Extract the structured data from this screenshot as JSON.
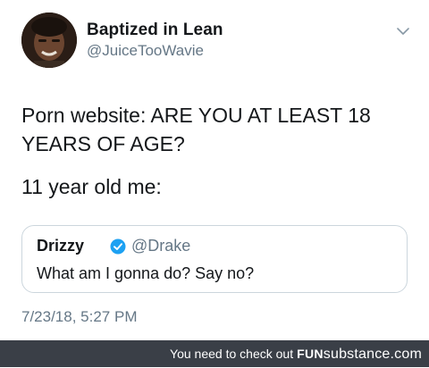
{
  "author": {
    "display_name": "Baptized in Lean",
    "handle": "@JuiceTooWavie",
    "avatar_icon": "user-avatar"
  },
  "menu_icon": "chevron-down-icon",
  "tweet": {
    "line1": "Porn website: ARE YOU AT LEAST 18 YEARS OF AGE?",
    "line2": "11 year old me:"
  },
  "quoted_tweet": {
    "display_name": "Drizzy",
    "verified_icon": "verified-badge-icon",
    "handle": "@Drake",
    "text": "What am I gonna do? Say no?"
  },
  "timestamp": "7/23/18, 5:27 PM",
  "footer": {
    "text": "You need to check out",
    "brand_bold": "FUN",
    "brand_rest": "substance.com"
  },
  "colors": {
    "verified_blue": "#1da1f2",
    "secondary_text": "#657786",
    "quote_border": "#ccd6dd",
    "footer_bg": "#3a3f47"
  }
}
